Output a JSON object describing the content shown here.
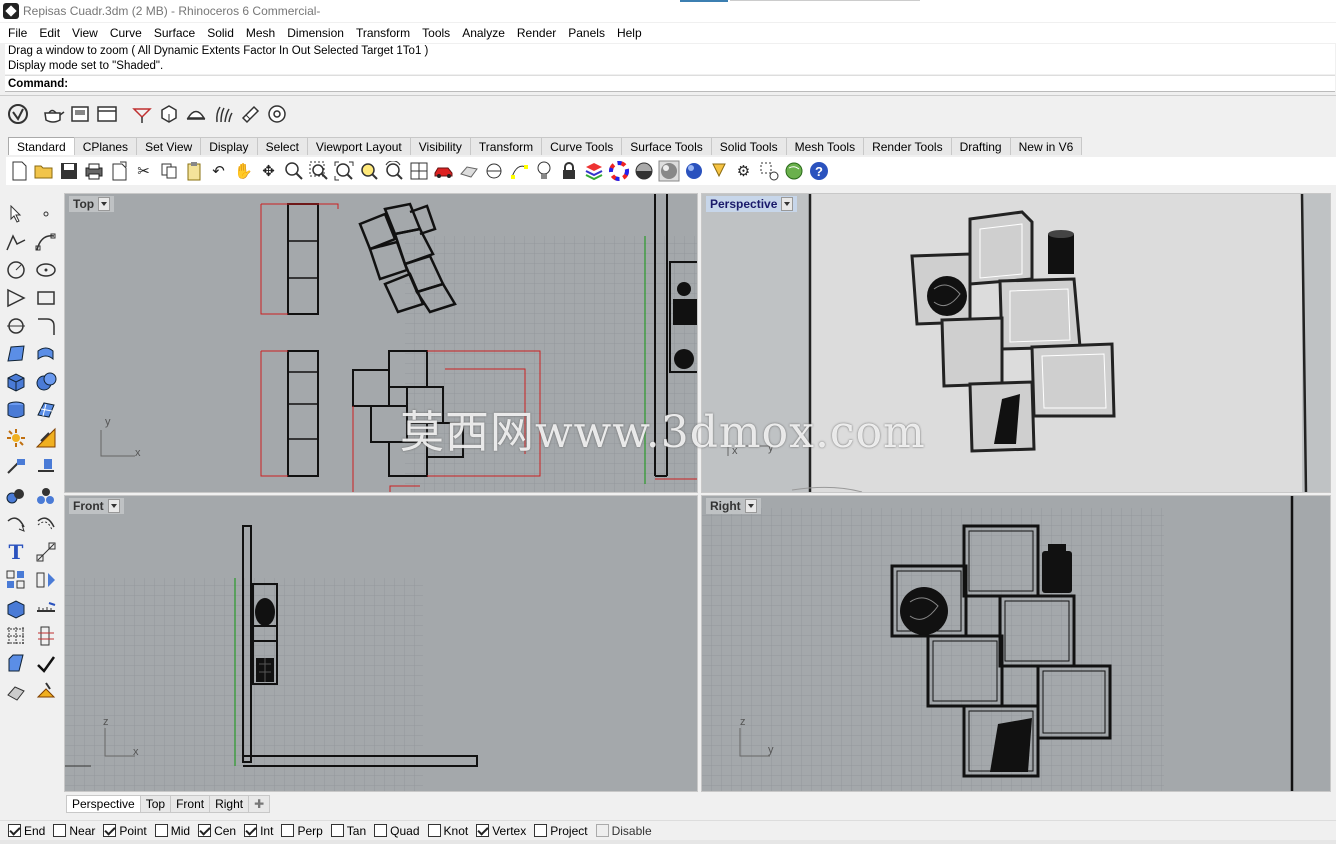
{
  "title": "Repisas Cuadr.3dm (2 MB) - Rhinoceros 6 Commercial-",
  "menu": [
    "File",
    "Edit",
    "View",
    "Curve",
    "Surface",
    "Solid",
    "Mesh",
    "Dimension",
    "Transform",
    "Tools",
    "Analyze",
    "Render",
    "Panels",
    "Help"
  ],
  "command_history": [
    "Drag a window to zoom ( All  Dynamic  Extents  Factor  In  Out  Selected  Target  1To1 )",
    "Display mode set to \"Shaded\"."
  ],
  "command_label": "Command:",
  "command_value": "",
  "toolbar_tabs": [
    "Standard",
    "CPlanes",
    "Set View",
    "Display",
    "Select",
    "Viewport Layout",
    "Visibility",
    "Transform",
    "Curve Tools",
    "Surface Tools",
    "Solid Tools",
    "Mesh Tools",
    "Render Tools",
    "Drafting",
    "New in V6"
  ],
  "active_tab": "Standard",
  "viewports": {
    "top": {
      "title": "Top",
      "axis_v": "y",
      "axis_h": "x"
    },
    "perspective": {
      "title": "Perspective",
      "axis_v": "y",
      "axis_h": "x"
    },
    "front": {
      "title": "Front",
      "axis_v": "z",
      "axis_h": "x"
    },
    "right": {
      "title": "Right",
      "axis_v": "z",
      "axis_h": "y"
    }
  },
  "watermark": "莫西网www.3dmox.com",
  "viewport_tabs": [
    "Perspective",
    "Top",
    "Front",
    "Right"
  ],
  "viewport_tab_add": "✚",
  "osnaps": [
    {
      "label": "End",
      "checked": true
    },
    {
      "label": "Near",
      "checked": false
    },
    {
      "label": "Point",
      "checked": true
    },
    {
      "label": "Mid",
      "checked": false
    },
    {
      "label": "Cen",
      "checked": true
    },
    {
      "label": "Int",
      "checked": true
    },
    {
      "label": "Perp",
      "checked": false
    },
    {
      "label": "Tan",
      "checked": false
    },
    {
      "label": "Quad",
      "checked": false
    },
    {
      "label": "Knot",
      "checked": false
    },
    {
      "label": "Vertex",
      "checked": true
    },
    {
      "label": "Project",
      "checked": false
    },
    {
      "label": "Disable",
      "checked": false,
      "disabled": true
    }
  ],
  "colors": {
    "viewport_bg": "#a4a8ab",
    "grid": "#8f9397",
    "red_line": "#cc2020",
    "green_axis": "#2a9a2a",
    "active_tab": "#c7d6ea"
  }
}
